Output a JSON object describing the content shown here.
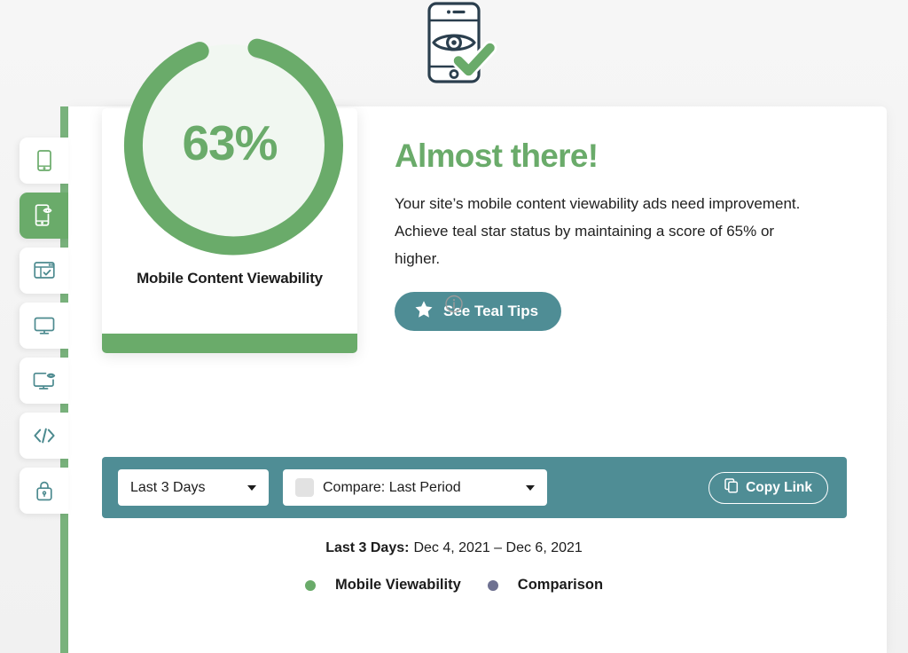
{
  "score_card": {
    "percent_label": "63%",
    "percent_value": 63,
    "metric_title": "Mobile Content Viewability",
    "info_icon": "info-circle-icon",
    "header_icon": "mobile-eye-check-icon",
    "ring_color": "#6aab6a",
    "ring_track_color": "#eef4ee",
    "footer_color": "#6aab6a"
  },
  "message": {
    "headline": "Almost there!",
    "body": "Your site’s mobile content viewability ads need improvement. Achieve teal star status by maintaining a score of 65% or higher.",
    "cta_label": "See Teal Tips",
    "cta_icon": "star-icon",
    "headline_color": "#6aab6a",
    "cta_color": "#4f8d95"
  },
  "toolbar": {
    "background_color": "#4f8d95",
    "date_range": {
      "value": "Last 3 Days",
      "caret_icon": "chevron-down-icon"
    },
    "compare": {
      "value": "Compare: Last Period",
      "checked": false,
      "caret_icon": "chevron-down-icon"
    },
    "copy_link": {
      "label": "Copy Link",
      "icon": "copy-icon"
    }
  },
  "date_summary": {
    "label": "Last 3 Days:",
    "value": "Dec 4, 2021 – Dec 6, 2021"
  },
  "legend": {
    "items": [
      {
        "label": "Mobile Viewability",
        "color": "#6aab6a"
      },
      {
        "label": "Comparison",
        "color": "#6e7191"
      }
    ]
  },
  "sidebar": {
    "items": [
      {
        "name": "mobile-device",
        "icon": "mobile-icon",
        "active": false,
        "green": true
      },
      {
        "name": "mobile-viewability",
        "icon": "mobile-eye-icon",
        "active": true,
        "green": false
      },
      {
        "name": "page-layout",
        "icon": "browser-check-icon",
        "active": false,
        "green": false
      },
      {
        "name": "desktop",
        "icon": "monitor-icon",
        "active": false,
        "green": false
      },
      {
        "name": "desktop-viewability",
        "icon": "monitor-eye-icon",
        "active": false,
        "green": false
      },
      {
        "name": "code",
        "icon": "code-brackets-icon",
        "active": false,
        "green": false
      },
      {
        "name": "security",
        "icon": "lock-icon",
        "active": false,
        "green": false
      }
    ]
  }
}
